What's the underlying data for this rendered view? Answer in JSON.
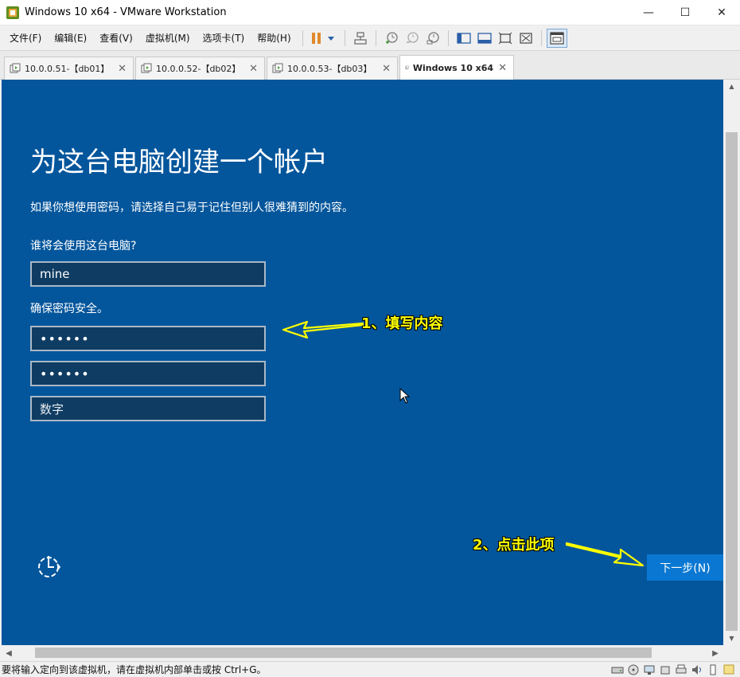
{
  "window": {
    "title": "Windows 10 x64 - VMware Workstation",
    "minimize": "—",
    "maximize": "☐",
    "close": "✕"
  },
  "menu": {
    "items": [
      "文件(F)",
      "编辑(E)",
      "查看(V)",
      "虚拟机(M)",
      "选项卡(T)",
      "帮助(H)"
    ]
  },
  "tabs": [
    {
      "label": "10.0.0.51-【db01】",
      "active": false
    },
    {
      "label": "10.0.0.52-【db02】",
      "active": false
    },
    {
      "label": "10.0.0.53-【db03】",
      "active": false
    },
    {
      "label": "Windows 10 x64",
      "active": true
    }
  ],
  "tab_close": "✕",
  "oobe": {
    "title": "为这台电脑创建一个帐户",
    "subtitle": "如果你想使用密码，请选择自己易于记住但别人很难猜到的内容。",
    "user_label": "谁将会使用这台电脑?",
    "user_value": "mine",
    "password_label": "确保密码安全。",
    "password_value": "••••••",
    "confirm_value": "••••••",
    "hint_value": "数字",
    "next_button": "下一步(N)"
  },
  "annotations": {
    "step1": "1、填写内容",
    "step2": "2、点击此项",
    "color": "#ffff00"
  },
  "status": {
    "text": "要将输入定向到该虚拟机，请在虚拟机内部单击或按 Ctrl+G。"
  },
  "colors": {
    "vm_background": "#04569c",
    "next_button": "#0a78d2"
  }
}
